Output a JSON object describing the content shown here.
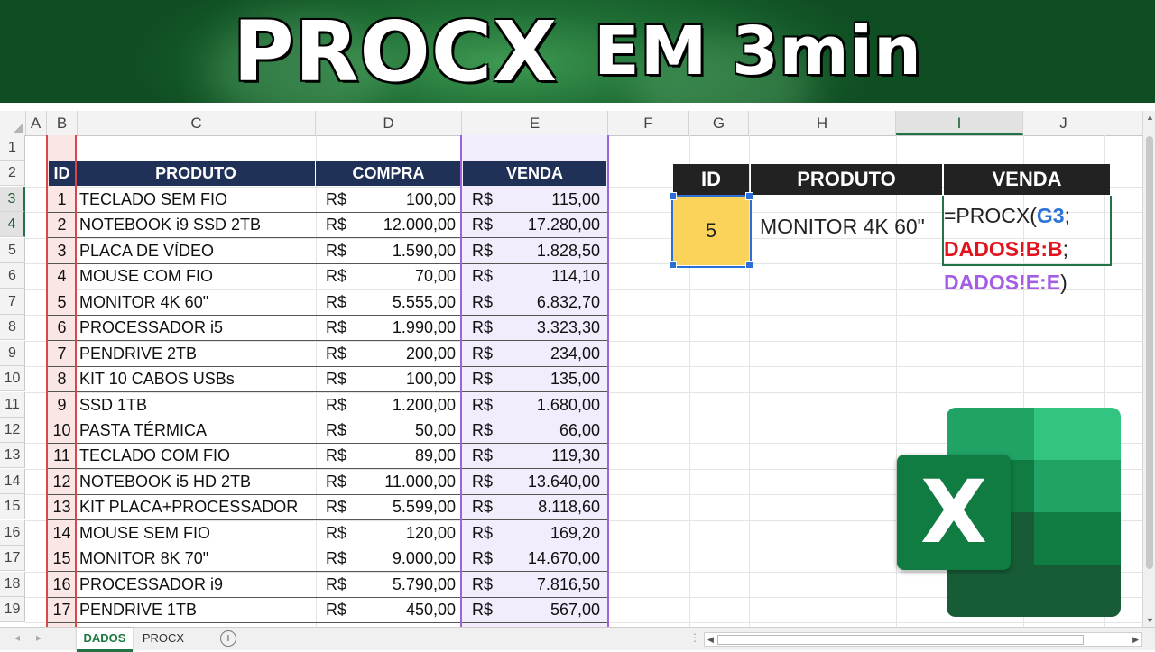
{
  "banner": {
    "title_main": "PROCX",
    "title_sub": "EM 3min"
  },
  "columns": [
    "A",
    "B",
    "C",
    "D",
    "E",
    "F",
    "G",
    "H",
    "I",
    "J"
  ],
  "rows": [
    "1",
    "2",
    "3",
    "4",
    "5",
    "6",
    "7",
    "8",
    "9",
    "10",
    "11",
    "12",
    "13",
    "14",
    "15",
    "16",
    "17",
    "18",
    "19"
  ],
  "table": {
    "headers": {
      "id": "ID",
      "produto": "PRODUTO",
      "compra": "COMPRA",
      "venda": "VENDA"
    },
    "currency": "R$",
    "rows": [
      {
        "id": "1",
        "produto": "TECLADO SEM FIO",
        "compra": "100,00",
        "venda": "115,00"
      },
      {
        "id": "2",
        "produto": "NOTEBOOK i9 SSD 2TB",
        "compra": "12.000,00",
        "venda": "17.280,00"
      },
      {
        "id": "3",
        "produto": "PLACA DE VÍDEO",
        "compra": "1.590,00",
        "venda": "1.828,50"
      },
      {
        "id": "4",
        "produto": "MOUSE COM FIO",
        "compra": "70,00",
        "venda": "114,10"
      },
      {
        "id": "5",
        "produto": "MONITOR 4K 60\"",
        "compra": "5.555,00",
        "venda": "6.832,70"
      },
      {
        "id": "6",
        "produto": "PROCESSADOR i5",
        "compra": "1.990,00",
        "venda": "3.323,30"
      },
      {
        "id": "7",
        "produto": "PENDRIVE 2TB",
        "compra": "200,00",
        "venda": "234,00"
      },
      {
        "id": "8",
        "produto": "KIT 10 CABOS USBs",
        "compra": "100,00",
        "venda": "135,00"
      },
      {
        "id": "9",
        "produto": "SSD 1TB",
        "compra": "1.200,00",
        "venda": "1.680,00"
      },
      {
        "id": "10",
        "produto": "PASTA TÉRMICA",
        "compra": "50,00",
        "venda": "66,00"
      },
      {
        "id": "11",
        "produto": "TECLADO COM FIO",
        "compra": "89,00",
        "venda": "119,30"
      },
      {
        "id": "12",
        "produto": "NOTEBOOK i5 HD 2TB",
        "compra": "11.000,00",
        "venda": "13.640,00"
      },
      {
        "id": "13",
        "produto": "KIT PLACA+PROCESSADOR",
        "compra": "5.599,00",
        "venda": "8.118,60"
      },
      {
        "id": "14",
        "produto": "MOUSE SEM FIO",
        "compra": "120,00",
        "venda": "169,20"
      },
      {
        "id": "15",
        "produto": "MONITOR 8K 70\"",
        "compra": "9.000,00",
        "venda": "14.670,00"
      },
      {
        "id": "16",
        "produto": "PROCESSADOR i9",
        "compra": "5.790,00",
        "venda": "7.816,50"
      },
      {
        "id": "17",
        "produto": "PENDRIVE 1TB",
        "compra": "450,00",
        "venda": "567,00"
      }
    ]
  },
  "lookup": {
    "headers": {
      "id": "ID",
      "produto": "PRODUTO",
      "venda": "VENDA"
    },
    "id_value": "5",
    "produto_value": "MONITOR 4K 60\"",
    "formula": {
      "line1_prefix": "=PROCX(",
      "line1_arg": "G3",
      "line1_suffix": ";",
      "line2_arg": "DADOS!B:B",
      "line2_suffix": ";",
      "line3_arg": "DADOS!E:E",
      "line3_suffix": ")"
    }
  },
  "sheets": [
    {
      "label": "DADOS",
      "active": true
    },
    {
      "label": "PROCX",
      "active": false
    }
  ],
  "add_sheet_symbol": "+",
  "logo": {
    "letter": "X"
  },
  "colors": {
    "excel_green": "#217346",
    "header_navy": "#1f3157",
    "id_yellow": "#fbd35b",
    "ref_blue": "#2b73d8",
    "ref_red": "#e0141d",
    "ref_purple": "#a45ee5"
  }
}
